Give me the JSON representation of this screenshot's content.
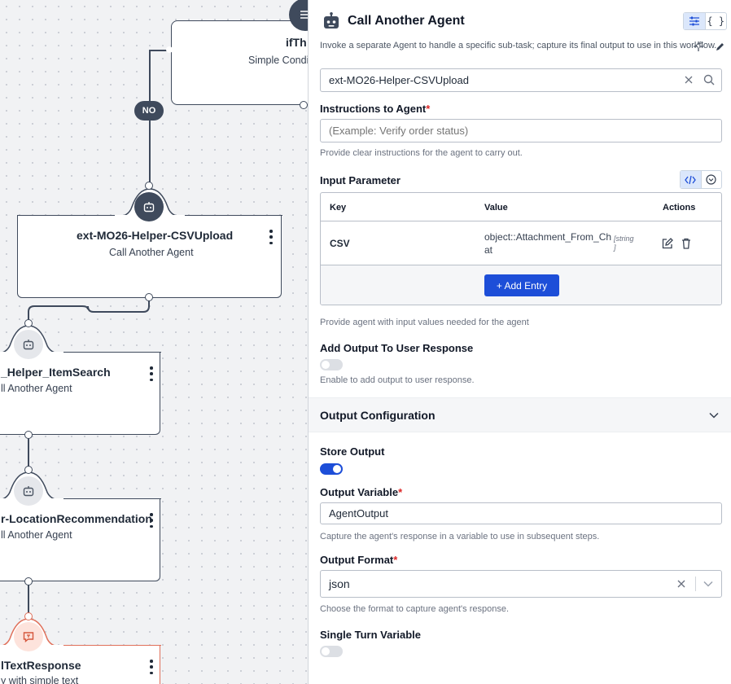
{
  "canvas": {
    "top_node": {
      "title": "ifTh",
      "subtitle": "Simple Condit"
    },
    "no_label": "NO",
    "main_node": {
      "title": "ext-MO26-Helper-CSVUpload",
      "subtitle": "Call Another Agent"
    },
    "node_item_search": {
      "title": "_Helper_ItemSearch",
      "subtitle": "ll Another Agent"
    },
    "node_location": {
      "title": "r-LocationRecommendation",
      "subtitle": "ll Another Agent"
    },
    "node_text_response": {
      "title": "lTextResponse",
      "subtitle": "y with simple text"
    },
    "colors": {
      "node_border": "#3f4a5c",
      "text_node_border": "#e0705a"
    }
  },
  "panel": {
    "header": {
      "title": "Call Another Agent",
      "description": "Invoke a separate Agent to handle a specific sub-task; capture its final output to use in this workflow."
    },
    "agent_select": {
      "value": "ext-MO26-Helper-CSVUpload"
    },
    "instructions": {
      "label": "Instructions to Agent",
      "required": "*",
      "placeholder": "(Example: Verify order status)",
      "help": "Provide clear instructions for the agent to carry out."
    },
    "input_parameter": {
      "label": "Input Parameter",
      "columns": {
        "key": "Key",
        "value": "Value",
        "actions": "Actions"
      },
      "rows": [
        {
          "key": "CSV",
          "value_line1": "object::Attachment_From_Ch",
          "value_line2": "at",
          "type_line1": "[string",
          "type_line2": "]"
        }
      ],
      "add_entry": "+ Add Entry",
      "help": "Provide agent with input values needed for the agent"
    },
    "add_output": {
      "label": "Add Output To User Response",
      "enabled": false,
      "help": "Enable to add output to user response."
    },
    "output_config": {
      "title": "Output Configuration",
      "store_output": {
        "label": "Store Output",
        "enabled": true
      },
      "output_variable": {
        "label": "Output Variable",
        "required": "*",
        "value": "AgentOutput",
        "help": "Capture the agent's response in a variable to use in subsequent steps."
      },
      "output_format": {
        "label": "Output Format",
        "required": "*",
        "value": "json",
        "help": "Choose the format to capture agent's response."
      },
      "single_turn": {
        "label": "Single Turn Variable",
        "enabled": false
      }
    },
    "colors": {
      "primary": "#1d4ed8",
      "required": "#dc2626",
      "muted_text": "#6b7280"
    }
  }
}
